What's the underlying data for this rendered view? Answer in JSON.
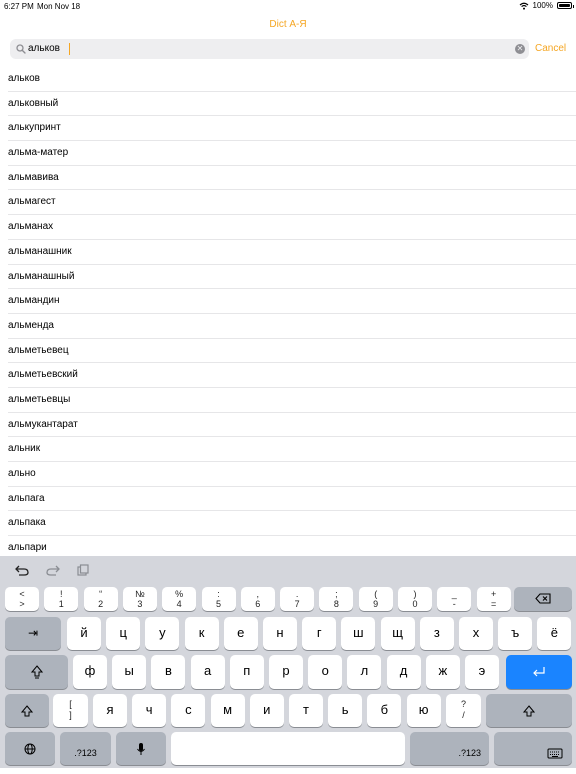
{
  "status": {
    "time": "6:27 PM",
    "date": "Mon Nov 18",
    "battery": "100%"
  },
  "title": "Dict А-Я",
  "search": {
    "value": "альков",
    "cancel_label": "Cancel"
  },
  "words": [
    "альков",
    "альковный",
    "алькупринт",
    "альма-матер",
    "альмавива",
    "альмагест",
    "альманах",
    "альманашник",
    "альманашный",
    "альмандин",
    "альменда",
    "альметьевец",
    "альметьевский",
    "альметьевцы",
    "альмукантарат",
    "альник",
    "ально",
    "альпага",
    "альпака",
    "альпари"
  ],
  "keyboard": {
    "toolbar": {
      "undo": "undo-icon",
      "redo": "redo-icon",
      "paste": "paste-icon"
    },
    "number_row": [
      {
        "top": "<",
        "bottom": ">"
      },
      {
        "top": "!",
        "bottom": "1"
      },
      {
        "top": "“",
        "bottom": "2"
      },
      {
        "top": "№",
        "bottom": "3"
      },
      {
        "top": "%",
        "bottom": "4"
      },
      {
        "top": ":",
        "bottom": "5"
      },
      {
        "top": ",",
        "bottom": "6"
      },
      {
        "top": ".",
        "bottom": "7"
      },
      {
        "top": ";",
        "bottom": "8"
      },
      {
        "top": "(",
        "bottom": "9"
      },
      {
        "top": ")",
        "bottom": "0"
      },
      {
        "top": "_",
        "bottom": "-"
      },
      {
        "top": "+",
        "bottom": "="
      }
    ],
    "row1": [
      "й",
      "ц",
      "у",
      "к",
      "е",
      "н",
      "г",
      "ш",
      "щ",
      "з",
      "х",
      "ъ",
      "ё"
    ],
    "row2": [
      "ф",
      "ы",
      "в",
      "а",
      "п",
      "р",
      "о",
      "л",
      "д",
      "ж",
      "э"
    ],
    "row3_bracket": {
      "top": "[",
      "bottom": "]"
    },
    "row3": [
      "я",
      "ч",
      "с",
      "м",
      "и",
      "т",
      "ь",
      "б",
      "ю"
    ],
    "row3_slash": {
      "top": "?",
      "bottom": "/"
    },
    "tab_label": "⇥",
    "numbers_label": ".?123",
    "numbers_label_right": ".?123"
  }
}
